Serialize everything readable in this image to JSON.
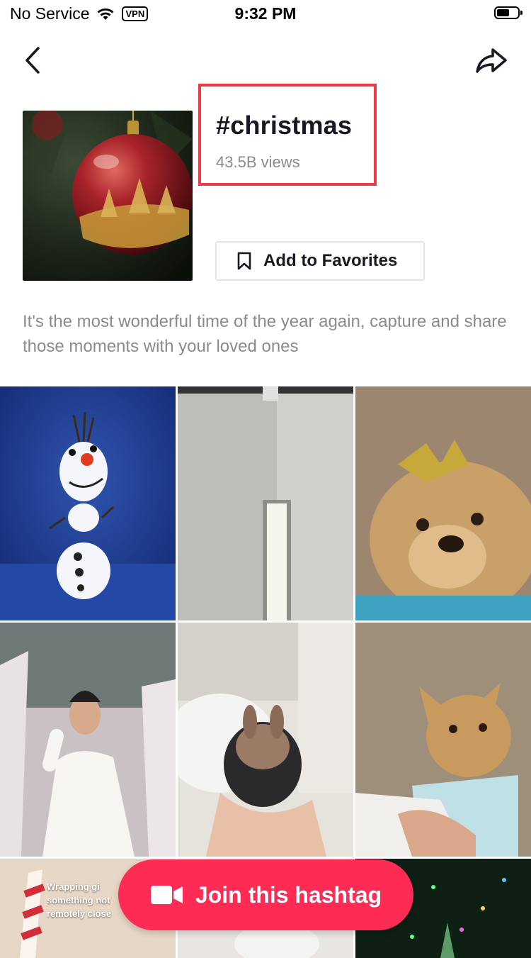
{
  "status_bar": {
    "carrier": "No Service",
    "vpn": "VPN",
    "time": "9:32 PM"
  },
  "header": {
    "back_icon": "chevron-left-icon",
    "share_icon": "share-arrow-icon"
  },
  "hashtag": {
    "title": "#christmas",
    "views": "43.5B views",
    "favorite_label": "Add to Favorites",
    "description": "It's the most wonderful time of the year again, capture and share those moments with your loved ones",
    "highlight_color": "#ee3a46"
  },
  "grid": {
    "overlay_lines": [
      "Wrapping gi",
      "something not",
      "remotely close"
    ]
  },
  "join_button": {
    "label": "Join this hashtag",
    "color": "#fe2c55",
    "icon": "video-camera-icon"
  }
}
